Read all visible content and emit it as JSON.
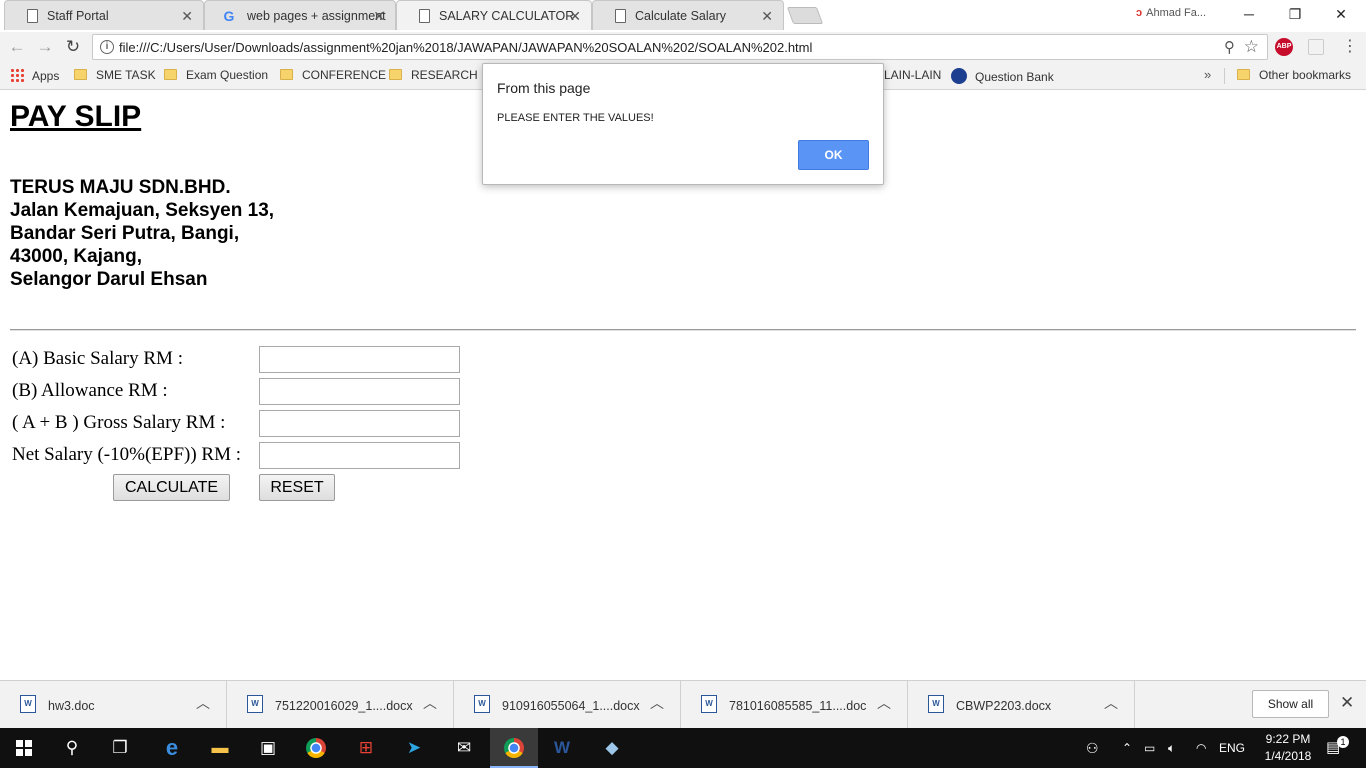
{
  "browser": {
    "tabs": [
      {
        "label": "Staff Portal"
      },
      {
        "label": "web pages + assignment"
      },
      {
        "label": "SALARY CALCULATOR"
      },
      {
        "label": "Calculate Salary"
      }
    ],
    "profile_name": "Ahmad Fa...",
    "url": "file:///C:/Users/User/Downloads/assignment%20jan%2018/JAWAPAN/JAWAPAN%20SOALAN%202/SOALAN%202.html",
    "abp_label": "ABP"
  },
  "bookmarks": {
    "apps": "Apps",
    "items": [
      "SME TASK",
      "Exam Question",
      "CONFERENCE",
      "RESEARCH PA",
      "LAIN-LAIN",
      "Question Bank"
    ],
    "other": "Other bookmarks"
  },
  "page": {
    "title": "PAY SLIP",
    "address_lines": [
      "TERUS MAJU SDN.BHD.",
      "Jalan Kemajuan, Seksyen 13,",
      "Bandar Seri Putra, Bangi,",
      "43000, Kajang,",
      "Selangor Darul Ehsan"
    ],
    "fields": [
      {
        "label": "(A) Basic Salary RM :",
        "value": ""
      },
      {
        "label": "(B) Allowance RM :",
        "value": ""
      },
      {
        "label": "( A + B ) Gross Salary RM :",
        "value": ""
      },
      {
        "label": "Net Salary (-10%(EPF)) RM :",
        "value": ""
      }
    ],
    "calculate_label": "CALCULATE",
    "reset_label": "RESET"
  },
  "dialog": {
    "title": "From this page",
    "message": "PLEASE ENTER THE VALUES!",
    "ok_label": "OK"
  },
  "downloads": {
    "items": [
      {
        "name": "hw3.doc"
      },
      {
        "name": "751220016029_1....docx"
      },
      {
        "name": "910916055064_1....docx"
      },
      {
        "name": "781016085585_11....doc"
      },
      {
        "name": "CBWP2203.docx"
      }
    ],
    "show_all_label": "Show all"
  },
  "taskbar": {
    "language": "ENG",
    "time": "9:22 PM",
    "date": "1/4/2018",
    "notification_count": "1"
  }
}
